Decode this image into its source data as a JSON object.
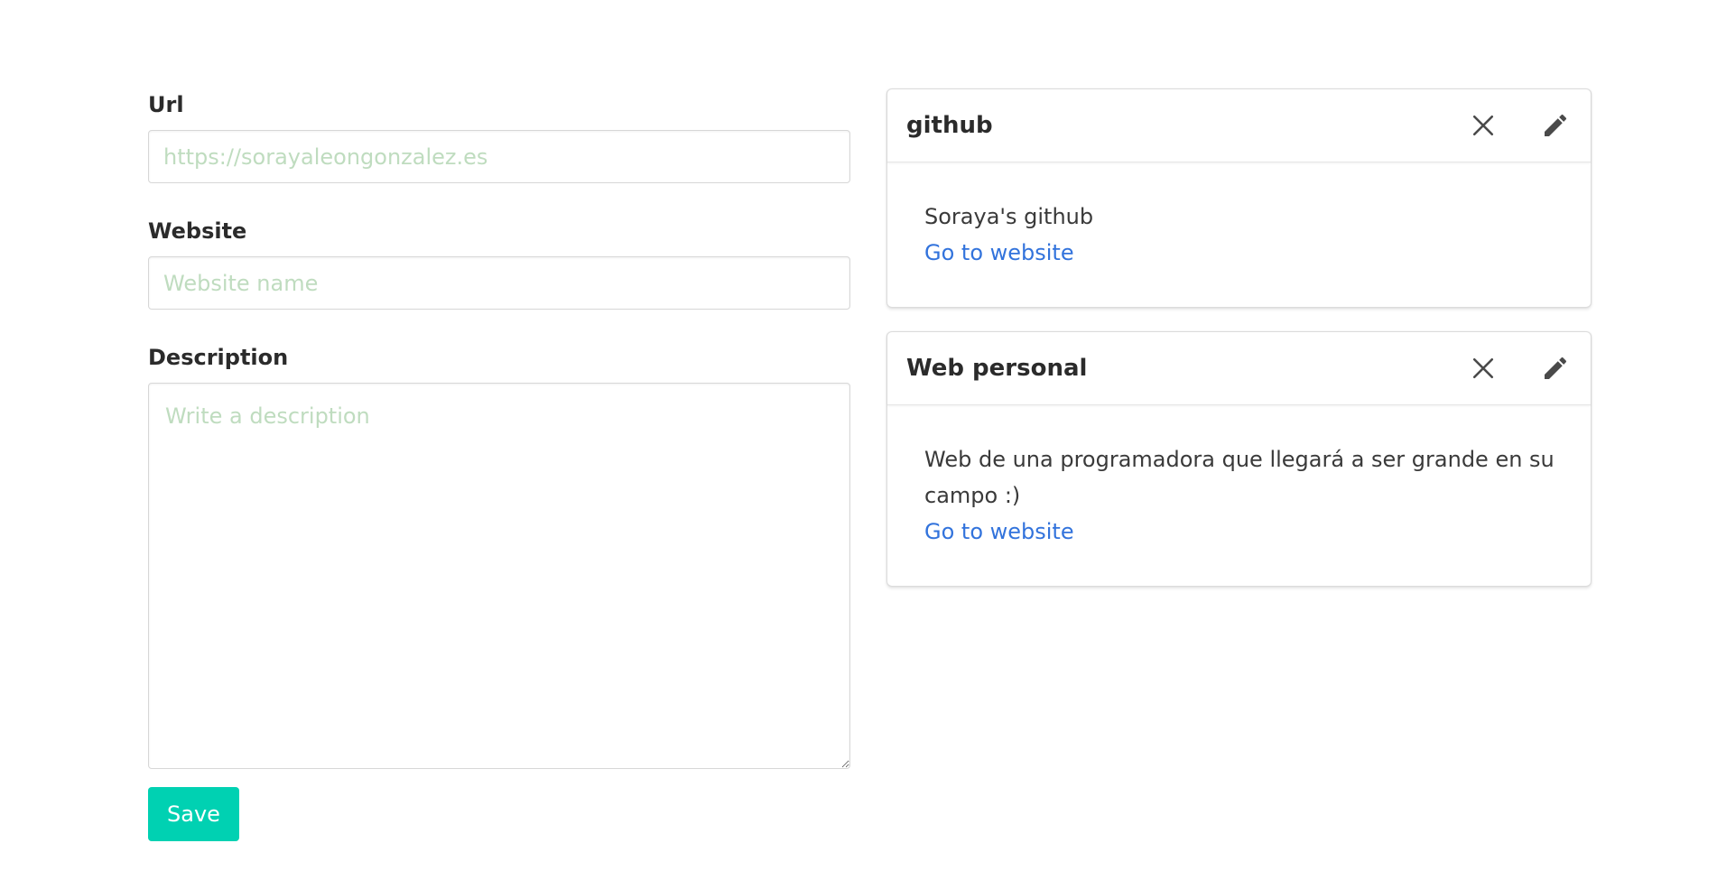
{
  "form": {
    "url": {
      "label": "Url",
      "value": "",
      "placeholder": "https://sorayaleongonzalez.es"
    },
    "website": {
      "label": "Website",
      "value": "",
      "placeholder": "Website name"
    },
    "description": {
      "label": "Description",
      "value": "",
      "placeholder": "Write a description"
    },
    "save_label": "Save"
  },
  "cards": [
    {
      "title": "github",
      "description": "Soraya's github",
      "link_label": "Go to website",
      "close_icon": "close-icon",
      "edit_icon": "pencil-icon"
    },
    {
      "title": "Web personal",
      "description": "Web de una programadora que llegará a ser grande en su campo :)",
      "link_label": "Go to website",
      "close_icon": "close-icon",
      "edit_icon": "pencil-icon"
    }
  ],
  "colors": {
    "primary_button": "#00d1b2",
    "link": "#3273dc",
    "placeholder": "#bfdcbf",
    "text": "#2b2b2b"
  }
}
